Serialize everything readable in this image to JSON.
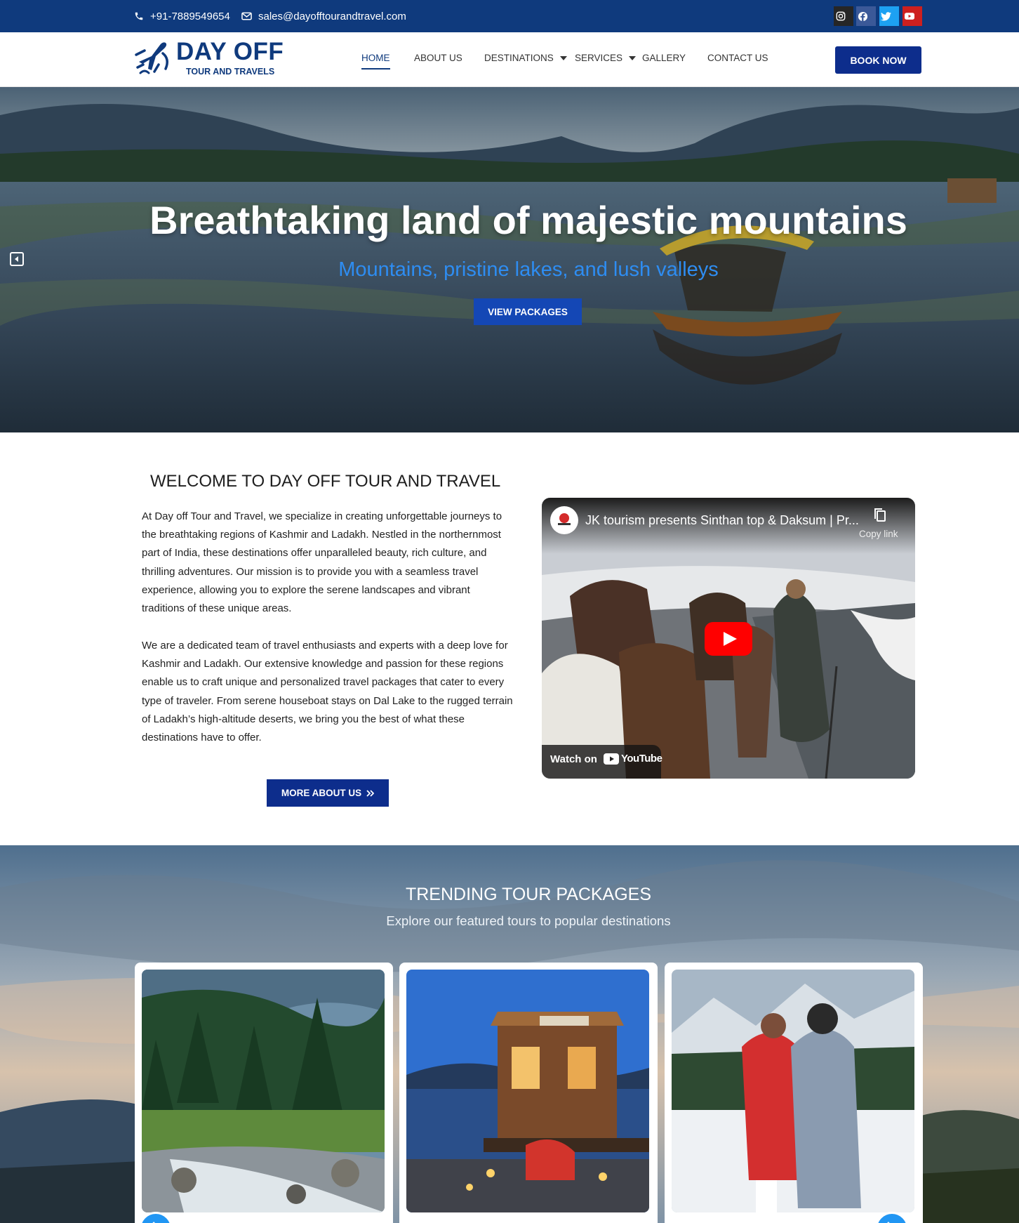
{
  "topbar": {
    "phone": "+91-7889549654",
    "email": "sales@dayofftourandtravel.com",
    "social": [
      {
        "icon": "instagram-icon",
        "color": "#262626"
      },
      {
        "icon": "facebook-icon",
        "color": "#3b5998"
      },
      {
        "icon": "twitter-icon",
        "color": "#1da1f2"
      },
      {
        "icon": "youtube-icon",
        "color": "#cd201f"
      }
    ]
  },
  "header": {
    "logo_title": "DAY OFF",
    "logo_subtitle": "TOUR AND TRAVELS",
    "nav": {
      "home": "HOME",
      "about": "ABOUT US",
      "destinations": "DESTINATIONS",
      "services": "SERVICES",
      "gallery": "GALLERY",
      "contact": "CONTACT US"
    },
    "book_now": "BOOK NOW",
    "brand_color": "#0f3a7d"
  },
  "hero": {
    "title": "Breathtaking land of majestic mountains",
    "subtitle": "Mountains, pristine lakes, and lush valleys",
    "button": "VIEW PACKAGES",
    "accent_color": "#2e8df2"
  },
  "welcome": {
    "title": "WELCOME TO DAY OFF TOUR AND TRAVEL",
    "paragraph1": "At Day off Tour and Travel, we specialize in creating unforgettable journeys to the breathtaking regions of Kashmir and Ladakh. Nestled in the northernmost part of India, these destinations offer unparalleled beauty, rich culture, and thrilling adventures. Our mission is to provide you with a seamless travel experience, allowing you to explore the serene landscapes and vibrant traditions of these unique areas.",
    "paragraph2": "We are a dedicated team of travel enthusiasts and experts with a deep love for Kashmir and Ladakh. Our extensive knowledge and passion for these regions enable us to craft unique and personalized travel packages that cater to every type of traveler. From serene houseboat stays on Dal Lake to the rugged terrain of Ladakh’s high-altitude deserts, we bring you the best of what these destinations have to offer.",
    "button": "MORE ABOUT US"
  },
  "video": {
    "title": "JK tourism presents Sinthan top & Daksum | Pr...",
    "copy_link": "Copy link",
    "watch_on": "Watch on",
    "youtube": "YouTube"
  },
  "trending": {
    "title": "TRENDING TOUR PACKAGES",
    "subtitle": "Explore our featured tours to popular destinations"
  }
}
